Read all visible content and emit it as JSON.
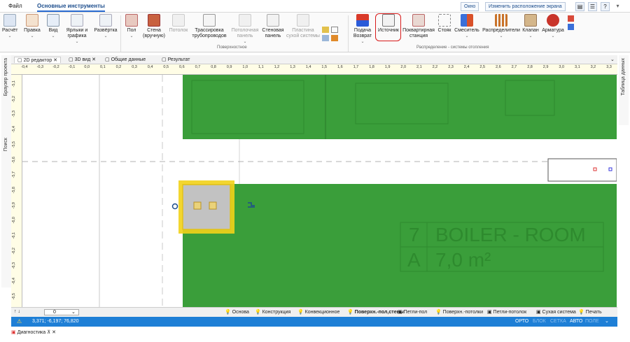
{
  "menu": {
    "file": "Файл",
    "main_tab": "Основные инструменты",
    "window": "Окно",
    "layout": "Изменить расположение экрана"
  },
  "ribbon": {
    "buttons": [
      {
        "label": "Расчёт",
        "id": "calc"
      },
      {
        "label": "Правка",
        "id": "edit"
      },
      {
        "label": "Вид",
        "id": "view"
      },
      {
        "label": "Ярлыки и графика",
        "id": "labels"
      },
      {
        "label": "Развёртка",
        "id": "unfold"
      },
      {
        "label": "Пол",
        "id": "floor"
      },
      {
        "label": "Стена (вручную)",
        "id": "wall"
      },
      {
        "label": "Потолок",
        "id": "ceiling"
      },
      {
        "label": "Трассировка трубопроводов",
        "id": "routing"
      },
      {
        "label": "Потолочная панель",
        "id": "ceilpanel"
      },
      {
        "label": "Стеновая панель",
        "id": "wallpanel"
      },
      {
        "label": "Пластина сухой системы",
        "id": "dryplate"
      },
      {
        "label": "Подача Возврат",
        "id": "supply"
      },
      {
        "label": "Источник",
        "id": "source"
      },
      {
        "label": "Поквартирная станция",
        "id": "station"
      },
      {
        "label": "Стояк",
        "id": "riser"
      },
      {
        "label": "Смеситель",
        "id": "mixer"
      },
      {
        "label": "Распределители",
        "id": "manifold"
      },
      {
        "label": "Клапан",
        "id": "valve"
      },
      {
        "label": "Арматура",
        "id": "fittings"
      }
    ],
    "group_surface": "Поверхностное",
    "group_distribution": "Распределение - системы отопления"
  },
  "doc_tabs": [
    "2D редактор",
    "3D вид",
    "Общие данные",
    "Результат"
  ],
  "left_panels": [
    "Браузер проекта",
    "Поиск"
  ],
  "right_panels": [
    "Таблица данных"
  ],
  "ruler_h": [
    "-0,4",
    "-0,3",
    "-0,2",
    "-0,1",
    "0,0",
    "0,1",
    "0,2",
    "0,3",
    "0,4",
    "0,5",
    "0,6",
    "0,7",
    "0,8",
    "0,9",
    "1,0",
    "1,1",
    "1,2",
    "1,3",
    "1,4",
    "1,5",
    "1,6",
    "1,7",
    "1,8",
    "1,9",
    "2,0",
    "2,1",
    "2,2",
    "2,3",
    "2,4",
    "2,5",
    "2,6",
    "2,7",
    "2,8",
    "2,9",
    "3,0",
    "3,1",
    "3,2",
    "3,3"
  ],
  "ruler_v": [
    "-5,1",
    "-5,2",
    "-5,3",
    "-5,4",
    "-5,5",
    "-5,6",
    "-5,7",
    "-5,8",
    "-5,9",
    "-6,0",
    "-6,1",
    "-6,2",
    "-6,3",
    "-6,4",
    "-6,5"
  ],
  "room": {
    "number": "7",
    "name": "BOILER - ROOM",
    "letter": "A",
    "area": "7,0 m²"
  },
  "layer_select": "0",
  "layers": [
    "Основа",
    "Конструкция",
    "Конвекционное",
    "Поверхн.-пол,стены",
    "Петли-пол",
    "Поверхн.-потолки",
    "Петли-потолок",
    "Сухая система",
    "Печать"
  ],
  "status": {
    "coords": "3,371; -6,197; 76,820",
    "modes": [
      "ОРТО",
      "БЛОК",
      "СЕТКА",
      "АВТО",
      "ПОЛЕ"
    ]
  },
  "bottom_panel": "Диагностика",
  "colors": {
    "floor_green": "#3a9e3a",
    "accent_blue": "#1e7fd6",
    "highlight_red": "#d81b1b",
    "selection_yellow": "#f2d21a"
  }
}
